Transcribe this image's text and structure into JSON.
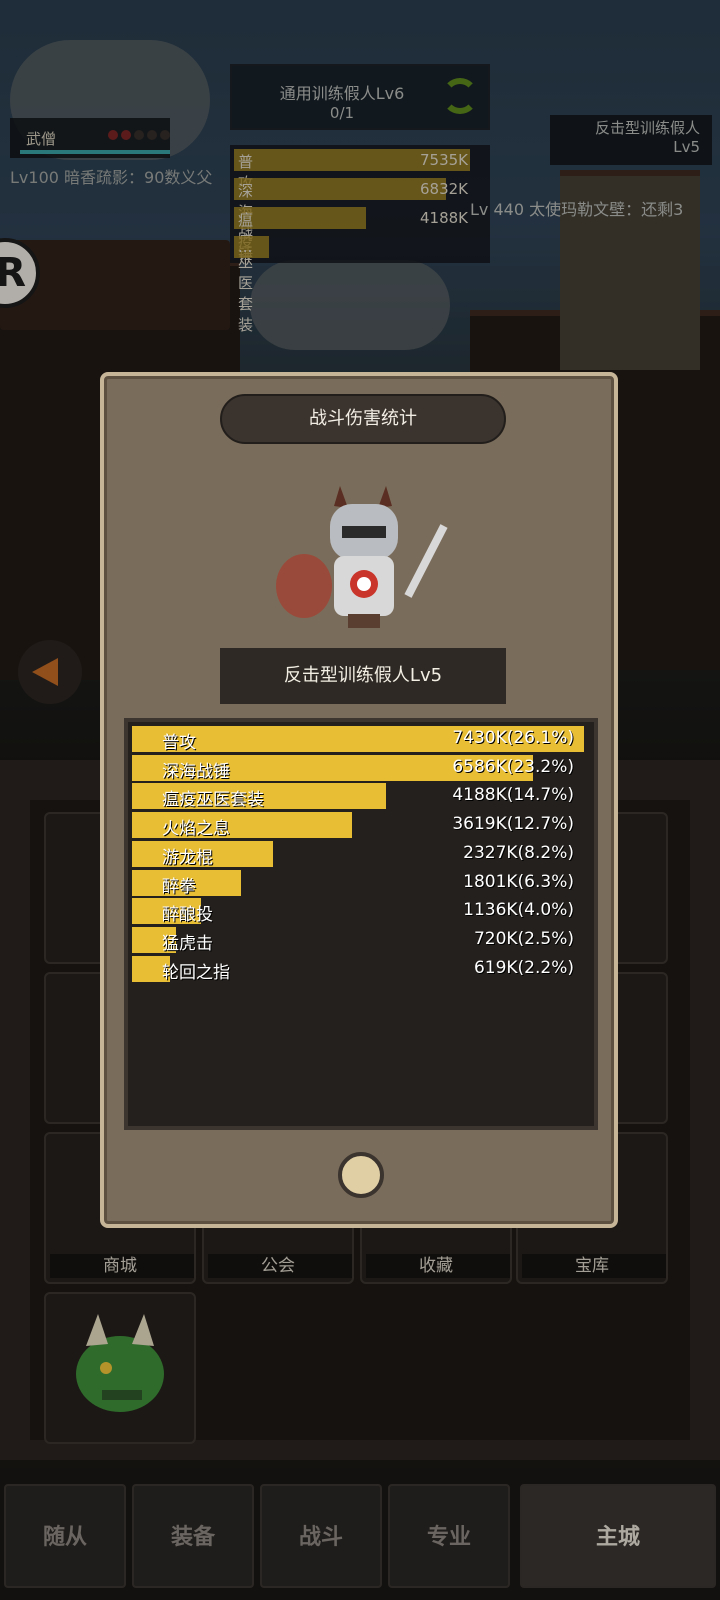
{
  "hud": {
    "dummy_title": "通用训练假人Lv6",
    "dummy_progress": "0/1",
    "left_hero_name": "武僧",
    "left_hero_line": "Lv100 暗香疏影：90数义父",
    "right_target_name": "反击型训练假人",
    "right_target_level": "Lv5",
    "right_target_line": "Lv 440 太使玛勒文壁：还剩3",
    "mini_list": [
      {
        "name": "普攻",
        "value": "7535K",
        "fill": 1.0
      },
      {
        "name": "深海战锤",
        "value": "6832K",
        "fill": 0.9
      },
      {
        "name": "瘟疫巫医套装",
        "value": "4188K",
        "fill": 0.56
      },
      {
        "name": "...",
        "value": "",
        "fill": 0.15
      }
    ]
  },
  "tiles": [
    {
      "label": "商城"
    },
    {
      "label": "公会"
    },
    {
      "label": "收藏"
    },
    {
      "label": "宝库"
    }
  ],
  "nav": [
    {
      "label": "随从"
    },
    {
      "label": "装备"
    },
    {
      "label": "战斗"
    },
    {
      "label": "专业"
    },
    {
      "label": "主城"
    }
  ],
  "modal": {
    "title": "战斗伤害统计",
    "target": "反击型训练假人Lv5",
    "rows": [
      {
        "name": "普攻",
        "value": "7430K(26.1%)",
        "share": 1.0
      },
      {
        "name": "深海战锤",
        "value": "6586K(23.2%)",
        "share": 0.887
      },
      {
        "name": "瘟疫巫医套装",
        "value": "4188K(14.7%)",
        "share": 0.563
      },
      {
        "name": "火焰之息",
        "value": "3619K(12.7%)",
        "share": 0.487
      },
      {
        "name": "游龙棍",
        "value": "2327K(8.2%)",
        "share": 0.313
      },
      {
        "name": "醉拳",
        "value": "1801K(6.3%)",
        "share": 0.242
      },
      {
        "name": "醉酿投",
        "value": "1136K(4.0%)",
        "share": 0.153
      },
      {
        "name": "猛虎击",
        "value": "720K(2.5%)",
        "share": 0.097
      },
      {
        "name": "轮回之指",
        "value": "619K(2.2%)",
        "share": 0.083
      }
    ]
  },
  "colors": {
    "bar": "#e8be35",
    "panel": "#7a6c5a"
  }
}
